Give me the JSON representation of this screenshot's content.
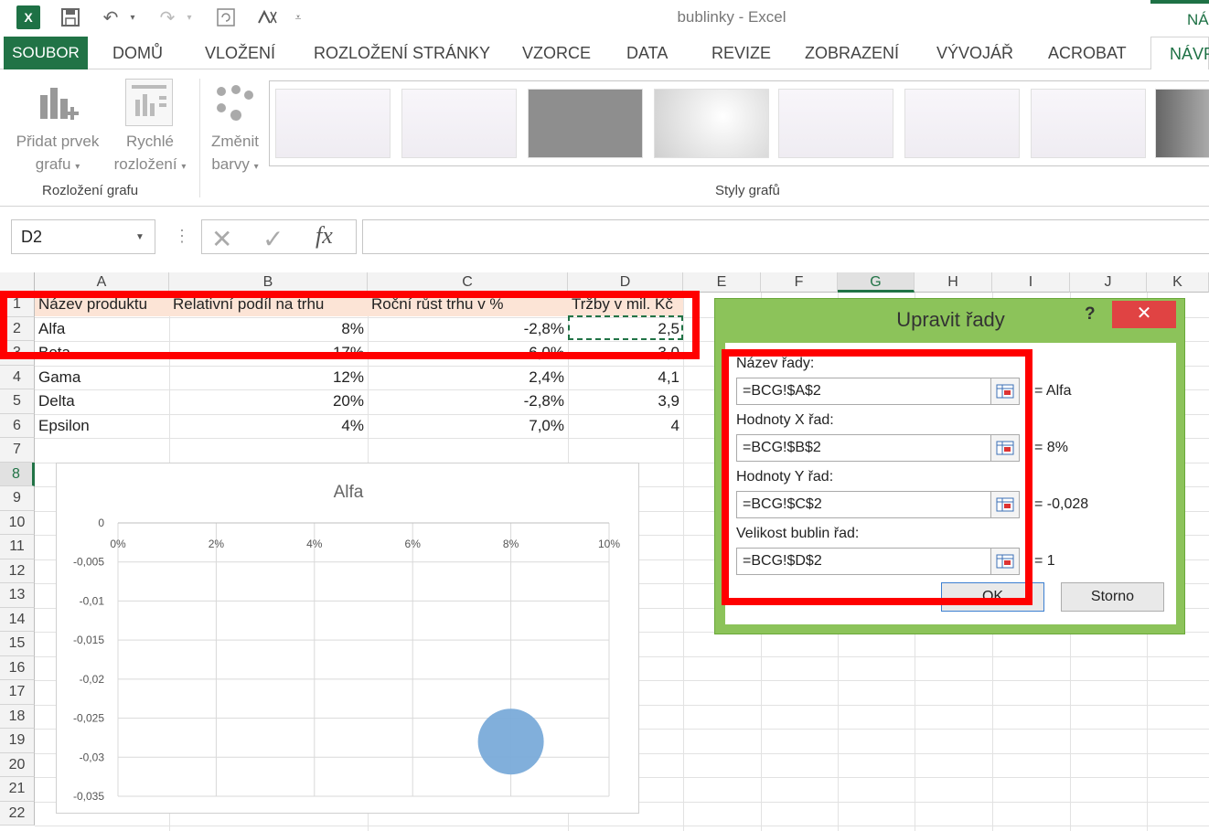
{
  "app": {
    "window_title": "bublinky - Excel",
    "top_right_tab": "NÁ"
  },
  "ribbon": {
    "tabs": [
      "SOUBOR",
      "DOMŮ",
      "VLOŽENÍ",
      "ROZLOŽENÍ STRÁNKY",
      "VZORCE",
      "DATA",
      "REVIZE",
      "ZOBRAZENÍ",
      "VÝVOJÁŘ",
      "ACROBAT",
      "NÁVR"
    ],
    "add_element_line1": "Přidat prvek",
    "add_element_line2": "grafu",
    "quick_layout_line1": "Rychlé",
    "quick_layout_line2": "rozložení",
    "change_colors_line1": "Změnit",
    "change_colors_line2": "barvy",
    "group_layout": "Rozložení grafu",
    "group_styles": "Styly grafů"
  },
  "formula_bar": {
    "name_box": "D2",
    "fx": "fx",
    "formula": ""
  },
  "sheet": {
    "columns": [
      "A",
      "B",
      "C",
      "D",
      "E",
      "F",
      "G",
      "H",
      "I",
      "J",
      "K"
    ],
    "rows": [
      "1",
      "2",
      "3",
      "4",
      "5",
      "6",
      "7",
      "8",
      "9",
      "10",
      "11",
      "12",
      "13",
      "14",
      "15",
      "16",
      "17",
      "18",
      "19",
      "20",
      "21",
      "22"
    ],
    "header": [
      "Název produktu",
      "Relativní podíl na trhu",
      "Roční růst trhu v %",
      "Tržby v mil. Kč"
    ],
    "data": [
      [
        "Alfa",
        "8%",
        "-2,8%",
        "2,5"
      ],
      [
        "Beta",
        "17%",
        "-6,0%",
        "3,0"
      ],
      [
        "Gama",
        "12%",
        "2,4%",
        "4,1"
      ],
      [
        "Delta",
        "20%",
        "-2,8%",
        "3,9"
      ],
      [
        "Epsilon",
        "4%",
        "7,0%",
        "4"
      ]
    ]
  },
  "chart_data": {
    "type": "scatter",
    "title": "Alfa",
    "x_tick_labels": [
      "0%",
      "2%",
      "4%",
      "6%",
      "8%",
      "10%"
    ],
    "y_tick_labels": [
      "0",
      "-0,005",
      "-0,01",
      "-0,015",
      "-0,02",
      "-0,025",
      "-0,03",
      "-0,035"
    ],
    "xlim": [
      0,
      0.1
    ],
    "ylim": [
      -0.035,
      0
    ],
    "x_axis_position": "top",
    "grid": true,
    "series": [
      {
        "x": [
          0.08
        ],
        "y": [
          -0.028
        ],
        "size": [
          2.5
        ],
        "color": "#7aabd9"
      }
    ]
  },
  "dialog": {
    "title": "Upravit řady",
    "help": "?",
    "close": "✕",
    "name_label": "Název řady:",
    "name_ref": "=BCG!$A$2",
    "name_value": "= Alfa",
    "x_label": "Hodnoty X řad:",
    "x_ref": "=BCG!$B$2",
    "x_value": "= 8%",
    "y_label": "Hodnoty Y řad:",
    "y_ref": "=BCG!$C$2",
    "y_value": "= -0,028",
    "size_label": "Velikost bublin řad:",
    "size_ref": "=BCG!$D$2",
    "size_value": "= 1",
    "ok": "OK",
    "cancel": "Storno"
  },
  "colors": {
    "excel_green": "#217346",
    "dialog_green": "#8cc35a",
    "close_red": "#e04343",
    "highlight_red": "#ff0000",
    "header_fill": "#fce4d6",
    "bubble": "#7aabd9"
  }
}
